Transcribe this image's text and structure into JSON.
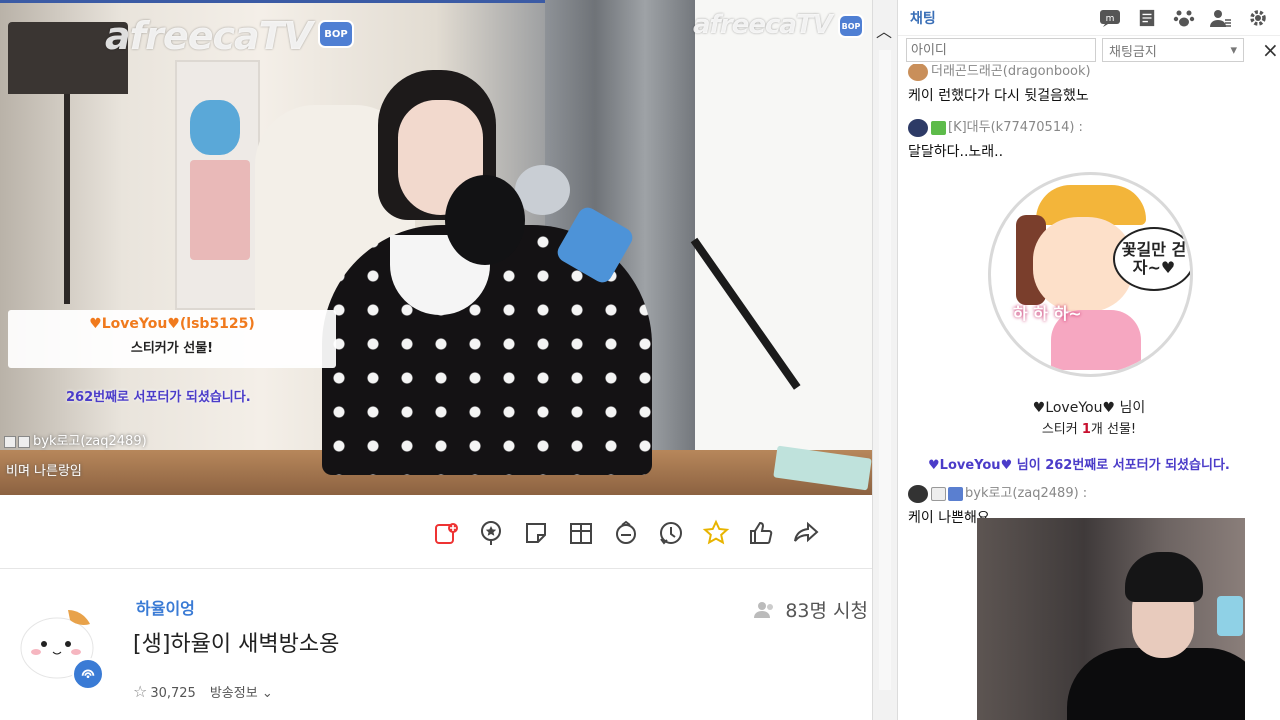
{
  "watermark": {
    "brand": "afreecaTV",
    "badge": "BOP"
  },
  "overlay": {
    "gift_sender": "♥LoveYou♥(lsb5125)",
    "gift_text": "스티커가 선물!",
    "support_msg": "262번째로 서포터가 되셨습니다.",
    "chat_user": "byk로고(zaq2489)",
    "chat_msg": "비며 나른랑임"
  },
  "actions": [
    {
      "name": "bookmark-add-icon",
      "label": "favorite-channel"
    },
    {
      "name": "star-balloon-icon",
      "label": "star-balloon"
    },
    {
      "name": "sticker-icon",
      "label": "sticker"
    },
    {
      "name": "gift-box-icon",
      "label": "gift"
    },
    {
      "name": "adballoon-icon",
      "label": "adballoon"
    },
    {
      "name": "time-machine-icon",
      "label": "time-machine"
    },
    {
      "name": "favorite-star-icon",
      "label": "favorite"
    },
    {
      "name": "thumbs-up-icon",
      "label": "up"
    },
    {
      "name": "share-icon",
      "label": "share"
    }
  ],
  "broadcast": {
    "bj_name": "하율이엉",
    "title": "[생]하율이 새벽방소옹",
    "viewers": "83명 시청",
    "favorites": "30,725",
    "info_label": "방송정보"
  },
  "chat": {
    "header": "채팅",
    "id_placeholder": "아이디",
    "filter_option": "채팅금지",
    "messages": [
      {
        "user": "더래곤드래곤(dragonbook)",
        "text": "케이 런했다가 다시 뒷걸음했노"
      },
      {
        "user": "[K]대두(k77470514) :",
        "text": "달달하다..노래.."
      },
      {
        "user": "byk로고(zaq2489) :",
        "text": "케이 나쁜해요"
      }
    ],
    "sticker_bubble": "꽃길만 걷자~♥",
    "sticker_laugh": "하 하 하~",
    "sticker_sender": "♥LoveYou♥ 님이",
    "sticker_gift_pre": "스티커 ",
    "sticker_gift_num": "1",
    "sticker_gift_post": "개 선물!",
    "support_line": "♥LoveYou♥ 님이 262번째로 서포터가 되셨습니다."
  },
  "colors": {
    "accent": "#3a7bd5",
    "support": "#4b3cc9",
    "gift": "#f07a1d"
  }
}
